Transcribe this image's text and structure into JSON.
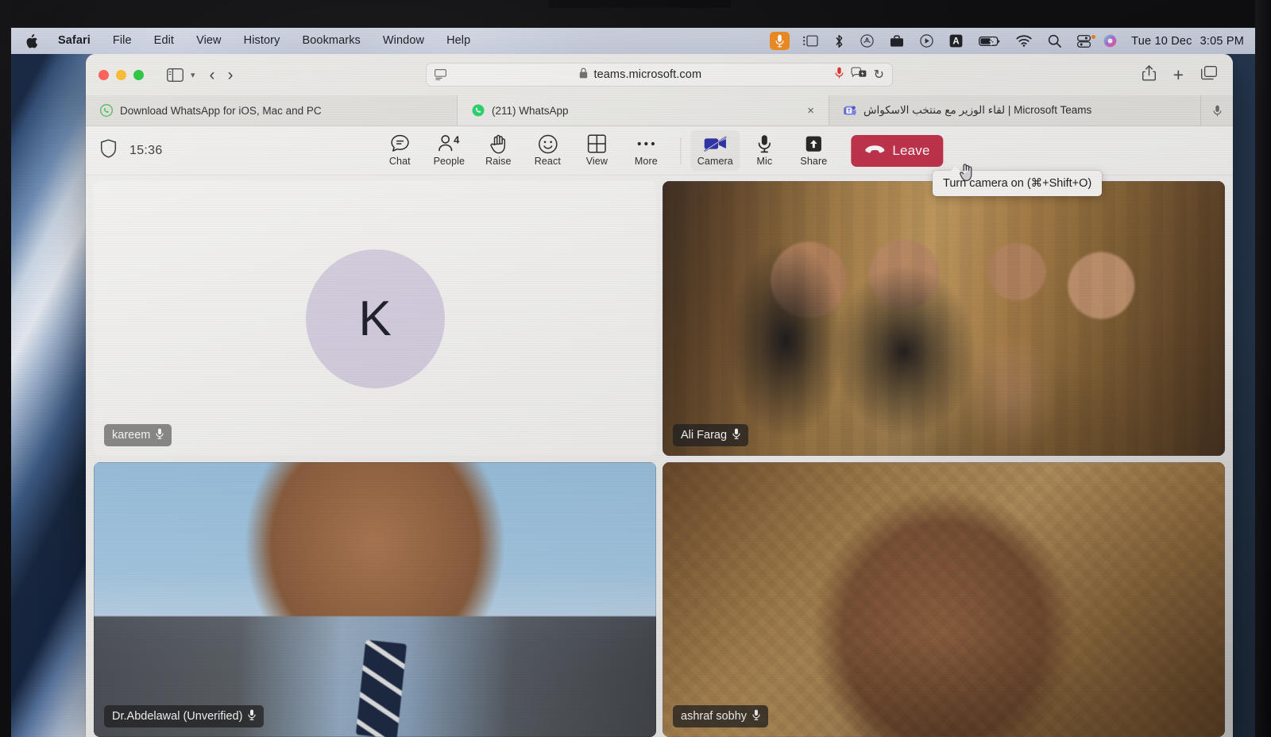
{
  "menubar": {
    "apple_icon": "apple-logo-icon",
    "items": [
      {
        "label": "Safari",
        "bold": true
      },
      {
        "label": "File",
        "bold": false
      },
      {
        "label": "Edit",
        "bold": false
      },
      {
        "label": "View",
        "bold": false
      },
      {
        "label": "History",
        "bold": false
      },
      {
        "label": "Bookmarks",
        "bold": false
      },
      {
        "label": "Window",
        "bold": false
      },
      {
        "label": "Help",
        "bold": false
      }
    ],
    "status_icons": [
      "microphone-in-use-icon",
      "screen-mirroring-icon",
      "bluetooth-icon",
      "airdrop-icon",
      "briefcase-icon",
      "now-playing-icon",
      "keyboard-input-language-icon",
      "battery-charging-icon",
      "wifi-icon",
      "spotlight-search-icon",
      "control-center-icon",
      "siri-icon"
    ],
    "clock": {
      "day": "Tue 10 Dec",
      "time": "3:05 PM"
    }
  },
  "safari": {
    "window_controls": [
      "close",
      "minimize",
      "zoom"
    ],
    "toolbar": {
      "sidebar_icon": "sidebar-toggle-icon",
      "sidebar_chevron": "chevron-down-icon",
      "back_glyph": "‹",
      "forward_glyph": "›",
      "url": "teams.microsoft.com",
      "lock_icon": "padlock-icon",
      "reader_icon": "reader-view-icon",
      "mic_icon": "microphone-active-icon",
      "extensions_icon": "extensions-icon",
      "reload_glyph": "↻",
      "share_icon": "share-icon",
      "new_tab_glyph": "+",
      "tab_overview_icon": "tab-overview-icon"
    },
    "tabs": [
      {
        "title": "Download WhatsApp for iOS, Mac and PC",
        "favicon": "whatsapp-icon",
        "active": false,
        "closable": false,
        "rtl": false
      },
      {
        "title": "(211) WhatsApp",
        "favicon": "whatsapp-icon",
        "active": true,
        "closable": true,
        "close_glyph": "×",
        "rtl": false
      },
      {
        "title": "لقاء الوزير مع منتخب الاسكواش | Microsoft Teams",
        "favicon": "microsoft-teams-icon",
        "active": false,
        "closable": false,
        "rtl": true
      }
    ],
    "tab_trailing_icon": "microphone-tab-icon"
  },
  "teams": {
    "toolbar": {
      "shield_icon": "shield-icon",
      "elapsed_time": "15:36",
      "buttons": [
        {
          "label": "Chat",
          "icon": "chat-bubble-icon",
          "badge": ""
        },
        {
          "label": "People",
          "icon": "people-icon",
          "badge": "4"
        },
        {
          "label": "Raise",
          "icon": "raise-hand-icon",
          "badge": ""
        },
        {
          "label": "React",
          "icon": "smiley-react-icon",
          "badge": ""
        },
        {
          "label": "View",
          "icon": "grid-view-icon",
          "badge": ""
        },
        {
          "label": "More",
          "icon": "more-ellipsis-icon",
          "badge": ""
        }
      ],
      "media_buttons": [
        {
          "label": "Camera",
          "icon": "camera-off-icon",
          "state": "off",
          "hovered": true
        },
        {
          "label": "Mic",
          "icon": "microphone-icon",
          "state": "on",
          "hovered": false
        },
        {
          "label": "Share",
          "icon": "share-screen-icon",
          "state": "on",
          "hovered": false
        }
      ],
      "leave": {
        "label": "Leave",
        "icon": "hang-up-icon",
        "color": "#c4314b"
      }
    },
    "tooltip": {
      "text": "Turn camera on (⌘+Shift+O)"
    },
    "cursor": {
      "icon": "pointing-hand-cursor"
    },
    "participants": [
      {
        "name": "kareem",
        "type": "avatar",
        "initial": "K",
        "avatar_color": "#d9d2e4",
        "mic_icon": "microphone-icon",
        "speaking": false,
        "badge_style": "light"
      },
      {
        "name": "Ali Farag",
        "type": "video",
        "video": "group-photo",
        "mic_icon": "microphone-icon",
        "speaking": true,
        "badge_style": "dark"
      },
      {
        "name": "Dr.Abdelawal (Unverified)",
        "type": "video",
        "video": "man-suit-outdoors",
        "mic_icon": "microphone-icon",
        "speaking": false,
        "badge_style": "dark"
      },
      {
        "name": "ashraf sobhy",
        "type": "video",
        "video": "man-gold-background",
        "mic_icon": "microphone-icon",
        "speaking": true,
        "badge_style": "dark"
      }
    ]
  },
  "colors": {
    "accent_speaking_border": "#5b5fc7",
    "leave_red": "#c4314b",
    "menubar_mic_orange": "#f08a1e",
    "teams_bg": "#f3f2f0"
  }
}
